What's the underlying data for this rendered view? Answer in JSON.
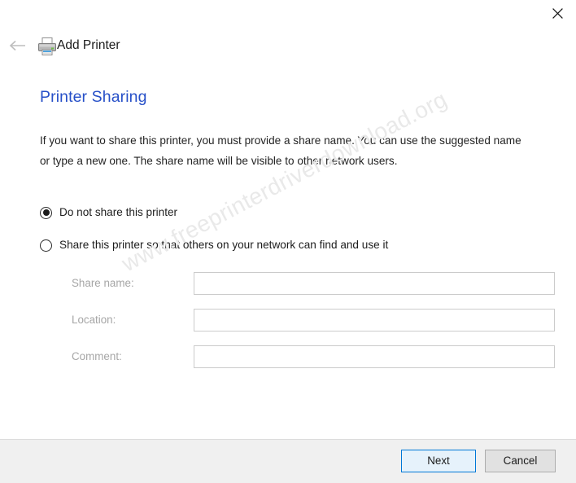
{
  "window": {
    "close_label": "Close",
    "close_icon": "close-icon"
  },
  "nav": {
    "back_icon": "arrow-left-icon",
    "printer_icon": "printer-icon",
    "app_title": "Add Printer"
  },
  "page": {
    "heading": "Printer Sharing",
    "description": "If you want to share this printer, you must provide a share name. You can use the suggested name or type a new one. The share name will be visible to other network users."
  },
  "sharing_options": {
    "selected": "do-not-share",
    "items": [
      {
        "id": "do-not-share",
        "label": "Do not share this printer",
        "checked": true
      },
      {
        "id": "share",
        "label": "Share this printer so that others on your network can find and use it",
        "checked": false
      }
    ]
  },
  "fields": [
    {
      "id": "share-name",
      "label": "Share name:",
      "value": "",
      "placeholder": "",
      "disabled": true
    },
    {
      "id": "location",
      "label": "Location:",
      "value": "",
      "placeholder": "",
      "disabled": true
    },
    {
      "id": "comment",
      "label": "Comment:",
      "value": "",
      "placeholder": "",
      "disabled": true
    }
  ],
  "footer": {
    "next_label": "Next",
    "cancel_label": "Cancel"
  },
  "watermark": {
    "text": "www.freeprinterdriverdownload.org"
  },
  "colors": {
    "heading_blue": "#2750c8",
    "accent_focus_border": "#0078d7",
    "next_fill": "#e6f2fb",
    "cancel_fill": "#e1e1e1",
    "footer_bg": "#f0f0f0",
    "input_border": "#cbcbcb",
    "disabled_label": "#a6a6a6",
    "watermark": "#e9e9e9"
  }
}
